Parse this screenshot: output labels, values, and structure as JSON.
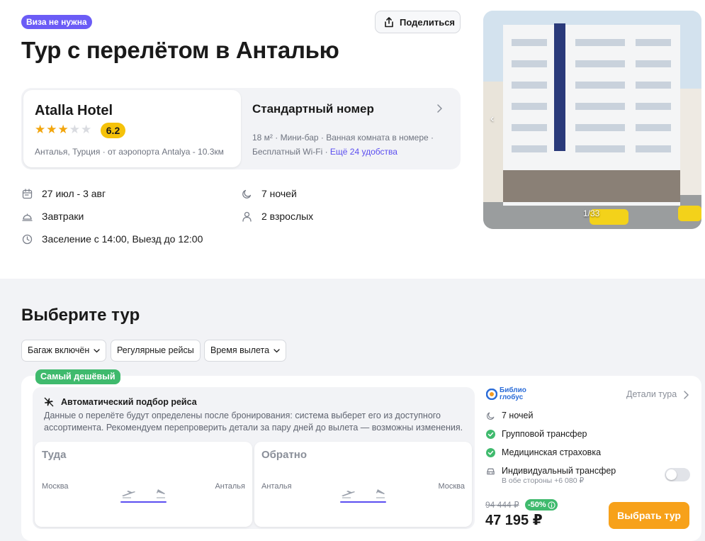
{
  "header": {
    "visa_badge": "Виза не нужна",
    "share_label": "Поделиться",
    "title": "Тур с перелётом в Анталью"
  },
  "hotel": {
    "name": "Atalla Hotel",
    "stars_filled": 3,
    "stars_total": 5,
    "rating": "6.2",
    "location": "Анталья, Турция · от аэропорта Antalya - 10.3км"
  },
  "room": {
    "title": "Стандартный номер",
    "features_line1": "18 м² · Мини-бар · Ванная комната в номере ·",
    "features_line2": "Бесплатный Wi-Fi · ",
    "more_link": "Ещё 24 удобства"
  },
  "trip_info": {
    "dates": "27 июл - 3 авг",
    "nights": "7 ночей",
    "meals": "Завтраки",
    "guests": "2 взрослых",
    "checkin": "Заселение с 14:00, Выезд до 12:00"
  },
  "gallery": {
    "counter": "1/33",
    "prev_icon": "chevron-left-icon"
  },
  "tours": {
    "title": "Выберите тур",
    "filters": [
      {
        "label": "Багаж включён",
        "dropdown": true
      },
      {
        "label": "Регулярные рейсы",
        "dropdown": false
      },
      {
        "label": "Время вылета",
        "dropdown": true
      }
    ],
    "card": {
      "badge": "Самый дешёвый",
      "flight_heading": "Автоматический подбор рейса",
      "flight_description": "Данные о перелёте будут определены после бронирования: система выберет его из доступного ассортимента. Рекомендуем перепроверить детали за пару дней до вылета — возможны изменения.",
      "outbound": {
        "title": "Туда",
        "from": "Москва",
        "to": "Анталья"
      },
      "return": {
        "title": "Обратно",
        "from": "Анталья",
        "to": "Москва"
      },
      "operator_line1": "Библио",
      "operator_line2": "глобус",
      "details_link": "Детали тура",
      "nights": "7 ночей",
      "group_transfer": "Групповой трансфер",
      "insurance": "Медицинская страховка",
      "individual_transfer": "Индивидуальный трансфер",
      "individual_transfer_sub": "В обе стороны +6 080 ₽",
      "individual_transfer_enabled": false,
      "old_price": "94 444 ₽",
      "discount": "-50%",
      "price": "47 195 ₽",
      "select_button": "Выбрать тур"
    }
  },
  "colors": {
    "accent": "#6b5cf6",
    "link": "#5b4ef0",
    "rating": "#f5c20a",
    "success": "#3fba6d",
    "cta": "#f7a11a"
  }
}
